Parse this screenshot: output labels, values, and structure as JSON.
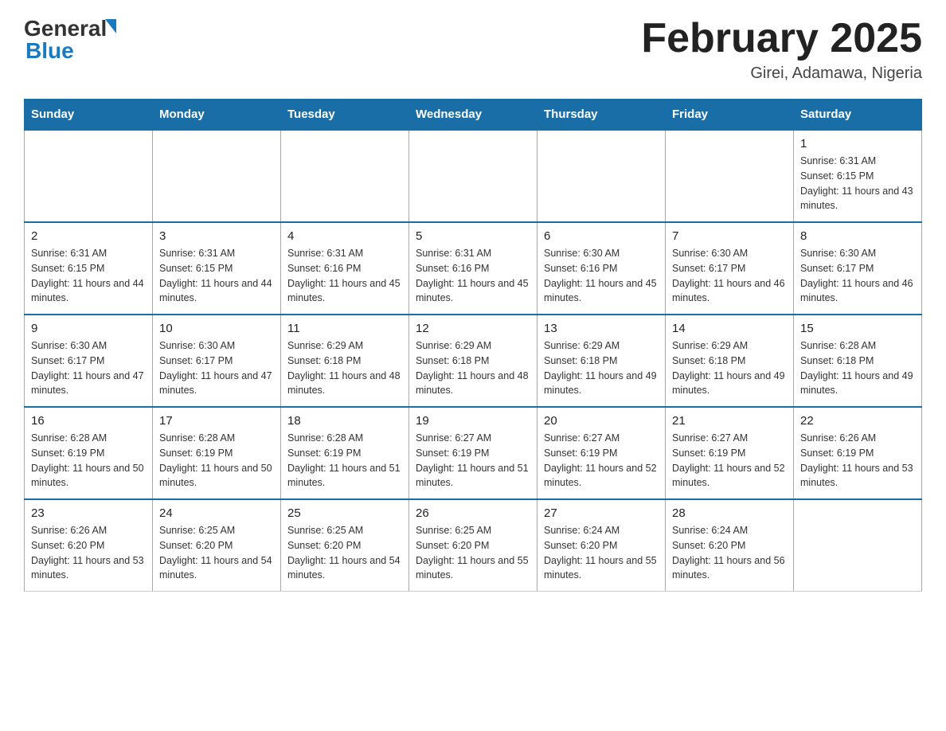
{
  "header": {
    "logo": {
      "text_general": "General",
      "text_blue": "Blue",
      "alt": "GeneralBlue logo"
    },
    "month_title": "February 2025",
    "location": "Girei, Adamawa, Nigeria"
  },
  "weekdays": [
    "Sunday",
    "Monday",
    "Tuesday",
    "Wednesday",
    "Thursday",
    "Friday",
    "Saturday"
  ],
  "weeks": [
    [
      {
        "day": "",
        "info": ""
      },
      {
        "day": "",
        "info": ""
      },
      {
        "day": "",
        "info": ""
      },
      {
        "day": "",
        "info": ""
      },
      {
        "day": "",
        "info": ""
      },
      {
        "day": "",
        "info": ""
      },
      {
        "day": "1",
        "info": "Sunrise: 6:31 AM\nSunset: 6:15 PM\nDaylight: 11 hours and 43 minutes."
      }
    ],
    [
      {
        "day": "2",
        "info": "Sunrise: 6:31 AM\nSunset: 6:15 PM\nDaylight: 11 hours and 44 minutes."
      },
      {
        "day": "3",
        "info": "Sunrise: 6:31 AM\nSunset: 6:15 PM\nDaylight: 11 hours and 44 minutes."
      },
      {
        "day": "4",
        "info": "Sunrise: 6:31 AM\nSunset: 6:16 PM\nDaylight: 11 hours and 45 minutes."
      },
      {
        "day": "5",
        "info": "Sunrise: 6:31 AM\nSunset: 6:16 PM\nDaylight: 11 hours and 45 minutes."
      },
      {
        "day": "6",
        "info": "Sunrise: 6:30 AM\nSunset: 6:16 PM\nDaylight: 11 hours and 45 minutes."
      },
      {
        "day": "7",
        "info": "Sunrise: 6:30 AM\nSunset: 6:17 PM\nDaylight: 11 hours and 46 minutes."
      },
      {
        "day": "8",
        "info": "Sunrise: 6:30 AM\nSunset: 6:17 PM\nDaylight: 11 hours and 46 minutes."
      }
    ],
    [
      {
        "day": "9",
        "info": "Sunrise: 6:30 AM\nSunset: 6:17 PM\nDaylight: 11 hours and 47 minutes."
      },
      {
        "day": "10",
        "info": "Sunrise: 6:30 AM\nSunset: 6:17 PM\nDaylight: 11 hours and 47 minutes."
      },
      {
        "day": "11",
        "info": "Sunrise: 6:29 AM\nSunset: 6:18 PM\nDaylight: 11 hours and 48 minutes."
      },
      {
        "day": "12",
        "info": "Sunrise: 6:29 AM\nSunset: 6:18 PM\nDaylight: 11 hours and 48 minutes."
      },
      {
        "day": "13",
        "info": "Sunrise: 6:29 AM\nSunset: 6:18 PM\nDaylight: 11 hours and 49 minutes."
      },
      {
        "day": "14",
        "info": "Sunrise: 6:29 AM\nSunset: 6:18 PM\nDaylight: 11 hours and 49 minutes."
      },
      {
        "day": "15",
        "info": "Sunrise: 6:28 AM\nSunset: 6:18 PM\nDaylight: 11 hours and 49 minutes."
      }
    ],
    [
      {
        "day": "16",
        "info": "Sunrise: 6:28 AM\nSunset: 6:19 PM\nDaylight: 11 hours and 50 minutes."
      },
      {
        "day": "17",
        "info": "Sunrise: 6:28 AM\nSunset: 6:19 PM\nDaylight: 11 hours and 50 minutes."
      },
      {
        "day": "18",
        "info": "Sunrise: 6:28 AM\nSunset: 6:19 PM\nDaylight: 11 hours and 51 minutes."
      },
      {
        "day": "19",
        "info": "Sunrise: 6:27 AM\nSunset: 6:19 PM\nDaylight: 11 hours and 51 minutes."
      },
      {
        "day": "20",
        "info": "Sunrise: 6:27 AM\nSunset: 6:19 PM\nDaylight: 11 hours and 52 minutes."
      },
      {
        "day": "21",
        "info": "Sunrise: 6:27 AM\nSunset: 6:19 PM\nDaylight: 11 hours and 52 minutes."
      },
      {
        "day": "22",
        "info": "Sunrise: 6:26 AM\nSunset: 6:19 PM\nDaylight: 11 hours and 53 minutes."
      }
    ],
    [
      {
        "day": "23",
        "info": "Sunrise: 6:26 AM\nSunset: 6:20 PM\nDaylight: 11 hours and 53 minutes."
      },
      {
        "day": "24",
        "info": "Sunrise: 6:25 AM\nSunset: 6:20 PM\nDaylight: 11 hours and 54 minutes."
      },
      {
        "day": "25",
        "info": "Sunrise: 6:25 AM\nSunset: 6:20 PM\nDaylight: 11 hours and 54 minutes."
      },
      {
        "day": "26",
        "info": "Sunrise: 6:25 AM\nSunset: 6:20 PM\nDaylight: 11 hours and 55 minutes."
      },
      {
        "day": "27",
        "info": "Sunrise: 6:24 AM\nSunset: 6:20 PM\nDaylight: 11 hours and 55 minutes."
      },
      {
        "day": "28",
        "info": "Sunrise: 6:24 AM\nSunset: 6:20 PM\nDaylight: 11 hours and 56 minutes."
      },
      {
        "day": "",
        "info": ""
      }
    ]
  ]
}
